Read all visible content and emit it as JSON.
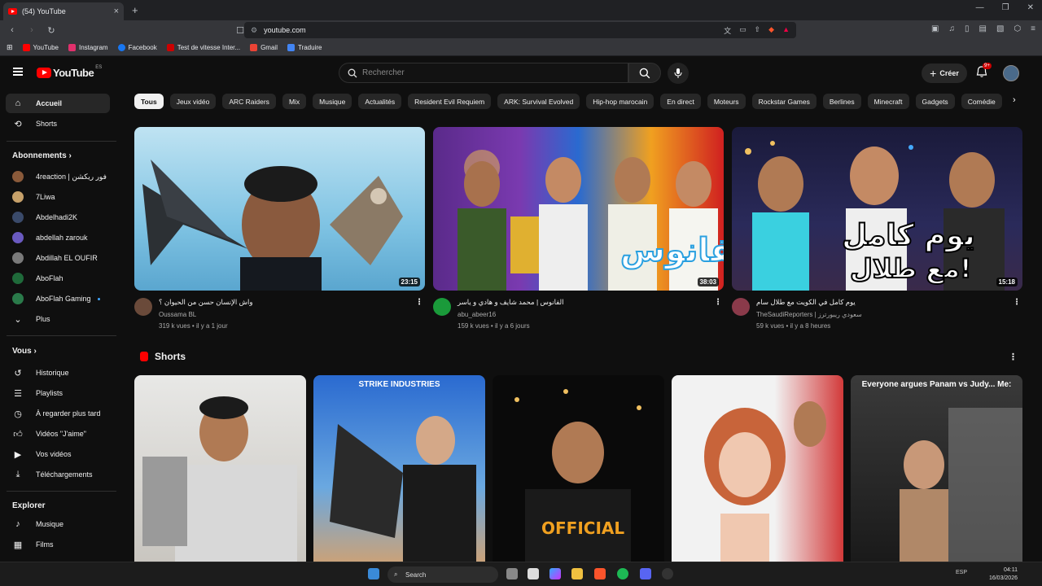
{
  "browser": {
    "tab_title": "(54) YouTube",
    "url": "youtube.com",
    "bookmarks": [
      {
        "label": "YouTube",
        "color": "#ff0000"
      },
      {
        "label": "Instagram",
        "color": "#e1306c"
      },
      {
        "label": "Facebook",
        "color": "#1877f2"
      },
      {
        "label": "Test de vitesse Inter...",
        "color": "#cc0000"
      },
      {
        "label": "Gmail",
        "color": "#ea4335"
      },
      {
        "label": "Traduire",
        "color": "#4285f4"
      }
    ]
  },
  "header": {
    "logo_text": "YouTube",
    "region": "ES",
    "search_placeholder": "Rechercher",
    "create_label": "Créer",
    "notif_count": "9+"
  },
  "sidebar": {
    "main": [
      {
        "label": "Accueil",
        "icon": "home-icon"
      },
      {
        "label": "Shorts",
        "icon": "shorts-icon"
      }
    ],
    "subs_title": "Abonnements",
    "subs": [
      {
        "label": "4reaction | فور ريكشن",
        "color": "#8a5a3a"
      },
      {
        "label": "7Liwa",
        "color": "#c7a16a"
      },
      {
        "label": "Abdelhadi2K",
        "color": "#3a4a6a"
      },
      {
        "label": "abdellah zarouk",
        "color": "#6a5ac0"
      },
      {
        "label": "Abdillah EL OUFIR",
        "color": "#7a7a7a"
      },
      {
        "label": "AboFlah",
        "color": "#1f6a3a"
      },
      {
        "label": "AboFlah Gaming",
        "color": "#2a7a4a"
      }
    ],
    "more_label": "Plus",
    "you_title": "Vous",
    "you": [
      {
        "label": "Historique"
      },
      {
        "label": "Playlists"
      },
      {
        "label": "À regarder plus tard"
      },
      {
        "label": "Vidéos \"J'aime\""
      },
      {
        "label": "Vos vidéos"
      },
      {
        "label": "Téléchargements"
      }
    ],
    "explore_title": "Explorer",
    "explore": [
      {
        "label": "Musique"
      },
      {
        "label": "Films"
      }
    ]
  },
  "chips": [
    "Tous",
    "Jeux vidéo",
    "ARC Raiders",
    "Mix",
    "Musique",
    "Actualités",
    "Resident Evil Requiem",
    "ARK: Survival Evolved",
    "Hip-hop marocain",
    "En direct",
    "Moteurs",
    "Rockstar Games",
    "Berlines",
    "Minecraft",
    "Gadgets",
    "Comédie"
  ],
  "videos": [
    {
      "title": "واش الإنسان حسن من الحيوان ؟",
      "channel": "Oussama BL",
      "meta": "319 k vues • il y a 1 jour",
      "duration": "23:15"
    },
    {
      "title": "الفانوس | محمد شايف و هادي و ياسر",
      "channel": "abu_abeer16",
      "meta": "159 k vues • il y a 6 jours",
      "duration": "38:03"
    },
    {
      "title": "يوم كامل في الكويت مع طلال سام",
      "channel": "TheSaudiReporters | سعودي ريبورترز",
      "meta": "59 k vues • il y a 8 heures",
      "duration": "15:18"
    }
  ],
  "shorts": {
    "title": "Shorts",
    "items": [
      {
        "caption": ""
      },
      {
        "caption": "STRIKE INDUSTRIES"
      },
      {
        "caption": ""
      },
      {
        "caption": ""
      },
      {
        "caption": "Everyone argues Panam vs Judy... Me:"
      }
    ]
  },
  "taskbar": {
    "search_label": "Search",
    "lang": "ESP",
    "time": "04:11",
    "date": "16/03/2026"
  }
}
